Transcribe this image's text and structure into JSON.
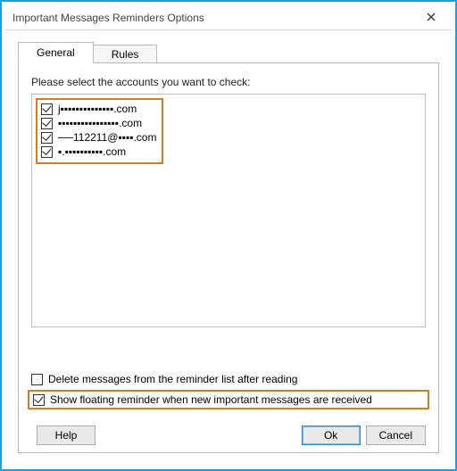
{
  "window": {
    "title": "Important Messages Reminders Options"
  },
  "tabs": {
    "general": "General",
    "rules": "Rules"
  },
  "general_panel": {
    "instruction": "Please select the accounts you want to check:",
    "accounts": [
      {
        "checked": true,
        "label": "j▪▪▪▪▪▪▪▪▪▪▪▪▪▪.com"
      },
      {
        "checked": true,
        "label": "▪▪▪▪▪▪▪▪▪▪▪▪▪▪▪▪.com"
      },
      {
        "checked": true,
        "label": "──112211@▪▪▪▪.com"
      },
      {
        "checked": true,
        "label": "▪.▪▪▪▪▪▪▪▪▪▪.com"
      }
    ],
    "delete_after_reading": {
      "checked": false,
      "label": "Delete messages from the reminder list after reading"
    },
    "show_floating": {
      "checked": true,
      "label": "Show floating reminder when new important messages are received"
    }
  },
  "buttons": {
    "help": "Help",
    "ok": "Ok",
    "cancel": "Cancel"
  },
  "colors": {
    "highlight": "#d97b1a",
    "frame": "#1e9fd8"
  }
}
